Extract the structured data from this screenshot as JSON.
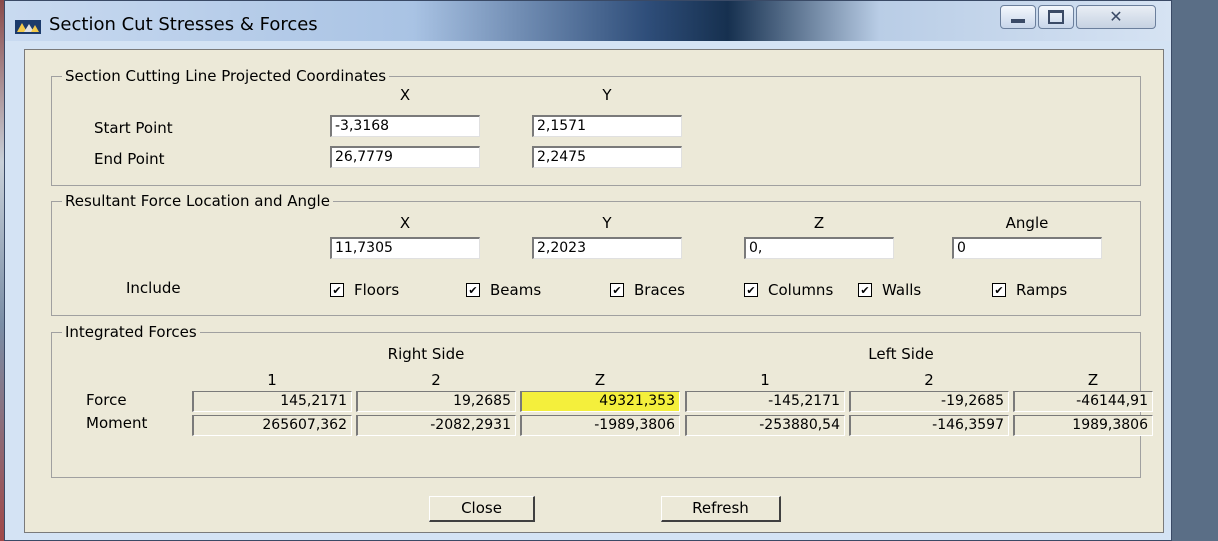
{
  "window": {
    "title": "Section Cut Stresses & Forces"
  },
  "coords_group": {
    "title": "Section Cutting Line Projected Coordinates",
    "x_header": "X",
    "y_header": "Y",
    "start_label": "Start Point",
    "end_label": "End Point",
    "start_x": "-3,3168",
    "start_y": "2,1571",
    "end_x": "26,7779",
    "end_y": "2,2475"
  },
  "resultant_group": {
    "title": "Resultant Force Location and Angle",
    "x_header": "X",
    "y_header": "Y",
    "z_header": "Z",
    "angle_header": "Angle",
    "x_value": "11,7305",
    "y_value": "2,2023",
    "z_value": "0,",
    "angle_value": "0",
    "include_label": "Include",
    "checkboxes": [
      {
        "label": "Floors",
        "checked": true
      },
      {
        "label": "Beams",
        "checked": true
      },
      {
        "label": "Braces",
        "checked": true
      },
      {
        "label": "Columns",
        "checked": true
      },
      {
        "label": "Walls",
        "checked": true
      },
      {
        "label": "Ramps",
        "checked": true
      }
    ]
  },
  "integrated_group": {
    "title": "Integrated Forces",
    "right_side": "Right Side",
    "left_side": "Left Side",
    "columns": [
      "1",
      "2",
      "Z",
      "1",
      "2",
      "Z"
    ],
    "force_label": "Force",
    "moment_label": "Moment",
    "force_values": [
      "145,2171",
      "19,2685",
      "49321,353",
      "-145,2171",
      "-19,2685",
      "-46144,91"
    ],
    "moment_values": [
      "265607,362",
      "-2082,2931",
      "-1989,3806",
      "-253880,54",
      "-146,3597",
      "1989,3806"
    ],
    "highlight_color": "#f4ef3c"
  },
  "buttons": {
    "close": "Close",
    "refresh": "Refresh"
  }
}
